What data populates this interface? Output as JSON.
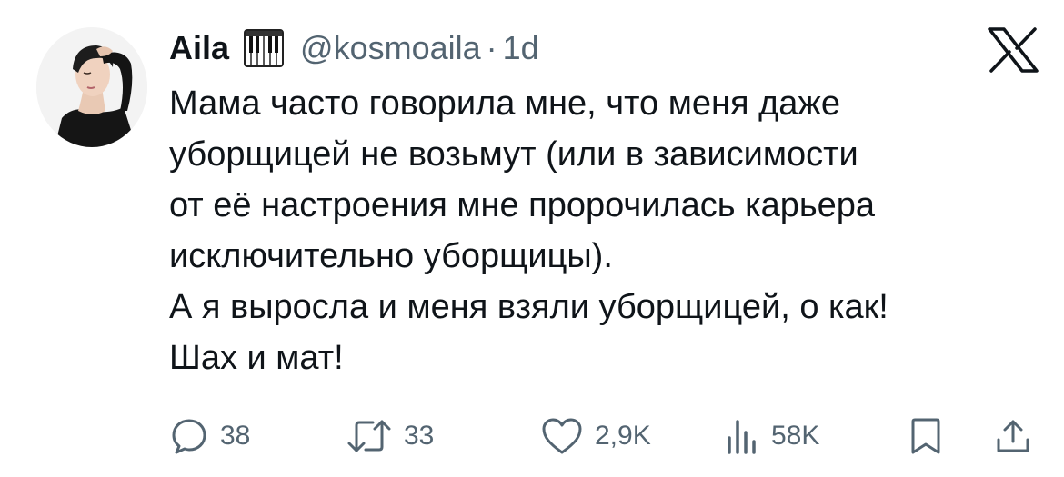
{
  "tweet": {
    "author": {
      "name": "Aila",
      "emoji_icon": "musical-keyboard-icon",
      "handle": "@kosmoaila",
      "separator": "·",
      "time": "1d"
    },
    "platform_icon": "x-logo-icon",
    "text_lines": [
      "Мама часто говорила мне, что меня даже",
      "уборщицей не возьмут (или в зависимости",
      "от её настроения мне пророчилась карьера",
      "исключительно уборщицы).",
      "А я выросла и меня взяли уборщицей, о как!",
      "Шах и мат!"
    ],
    "actions": {
      "reply": {
        "icon": "reply-icon",
        "count": "38"
      },
      "retweet": {
        "icon": "retweet-icon",
        "count": "33"
      },
      "like": {
        "icon": "heart-icon",
        "count": "2,9K"
      },
      "views": {
        "icon": "views-icon",
        "count": "58K"
      },
      "bookmark": {
        "icon": "bookmark-icon"
      },
      "share": {
        "icon": "share-icon"
      }
    },
    "colors": {
      "text": "#0f1419",
      "secondary": "#536471",
      "background": "#ffffff"
    }
  }
}
